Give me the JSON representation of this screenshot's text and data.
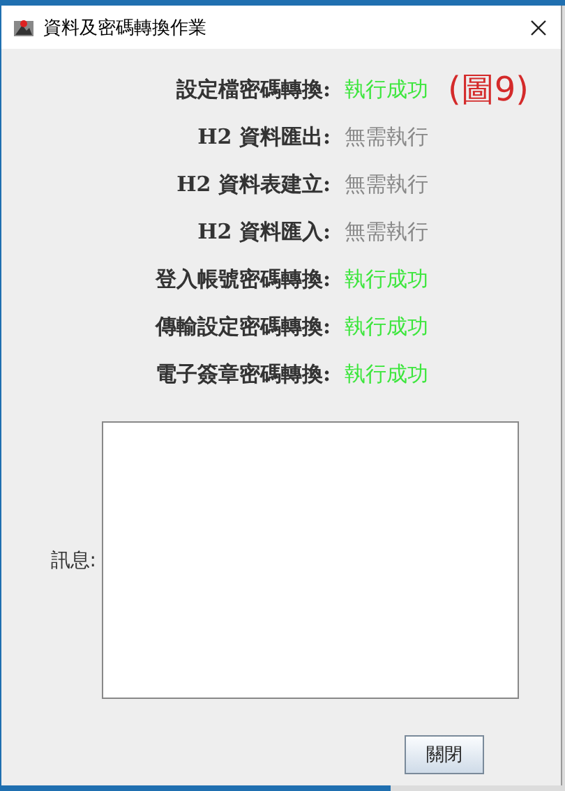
{
  "window": {
    "title": "資料及密碼轉換作業"
  },
  "annotation": "(圖9)",
  "rows": [
    {
      "label": "設定檔密碼轉換:",
      "status": "執行成功",
      "color": "#3ce63c"
    },
    {
      "label": "H2 資料匯出:",
      "status": "無需執行",
      "color": "#888888"
    },
    {
      "label": "H2 資料表建立:",
      "status": "無需執行",
      "color": "#888888"
    },
    {
      "label": "H2 資料匯入:",
      "status": "無需執行",
      "color": "#888888"
    },
    {
      "label": "登入帳號密碼轉換:",
      "status": "執行成功",
      "color": "#3ce63c"
    },
    {
      "label": "傳輸設定密碼轉換:",
      "status": "執行成功",
      "color": "#3ce63c"
    },
    {
      "label": "電子簽章密碼轉換:",
      "status": "執行成功",
      "color": "#3ce63c"
    }
  ],
  "message": {
    "label": "訊息:"
  },
  "buttons": [
    "關閉"
  ]
}
